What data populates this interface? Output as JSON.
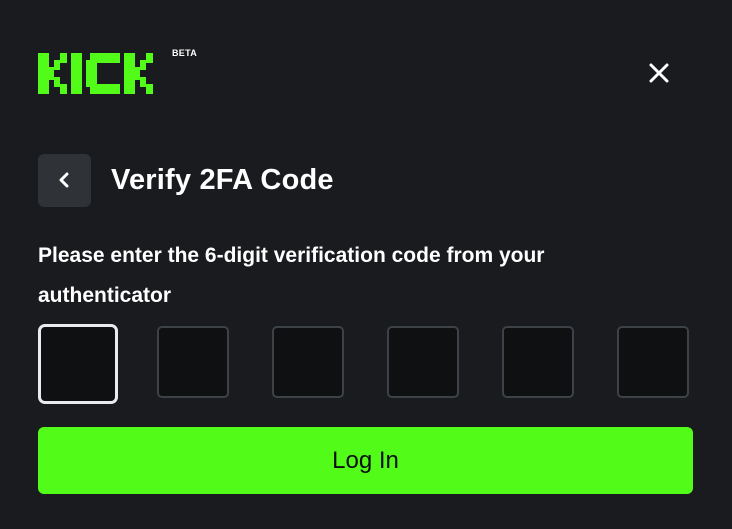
{
  "brand": {
    "logo_text": "KICK",
    "badge": "BETA",
    "logo_color": "#53fc18"
  },
  "close_icon": "close-icon",
  "header": {
    "back_icon": "chevron-left-icon",
    "title": "Verify 2FA Code"
  },
  "instructions": "Please enter the 6-digit verification code from your authenticator",
  "code_inputs": [
    {
      "value": "",
      "focused": true
    },
    {
      "value": "",
      "focused": false
    },
    {
      "value": "",
      "focused": false
    },
    {
      "value": "",
      "focused": false
    },
    {
      "value": "",
      "focused": false
    },
    {
      "value": "",
      "focused": false
    }
  ],
  "login_button": {
    "label": "Log In",
    "color": "#53fc18"
  },
  "colors": {
    "background": "#191b1f",
    "button_secondary": "#2f3338",
    "input_border": "#3d4247",
    "input_focus_border": "#e9ebec"
  }
}
